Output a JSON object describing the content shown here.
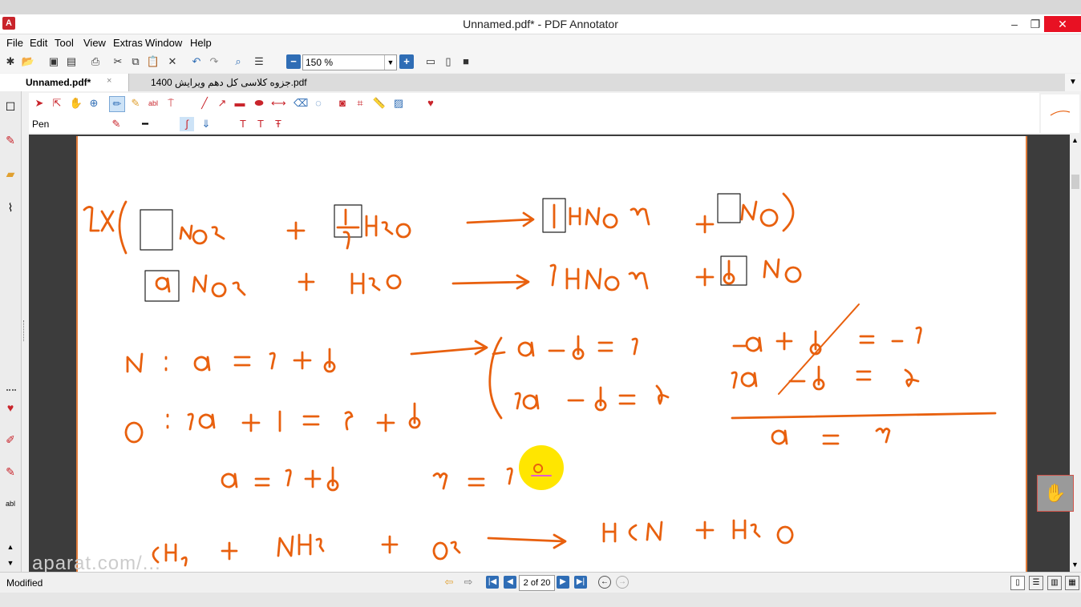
{
  "window": {
    "title": "Unnamed.pdf* - PDF Annotator",
    "app_icon": "pdf-annotator-logo",
    "minimize": "–",
    "maximize": "❐",
    "close": "✕"
  },
  "menu": [
    "File",
    "Edit",
    "Tool",
    "View",
    "Extras",
    "Window",
    "Help"
  ],
  "toolbar": {
    "zoom_value": "150 %",
    "zoom_out": "−",
    "zoom_in": "+"
  },
  "tabs": [
    {
      "label": "Unnamed.pdf*",
      "close": "×",
      "active": true
    },
    {
      "label": "جزوه کلاسی کل دهم ویرایش 1400.pdf",
      "active": false
    }
  ],
  "annotation_toolbar": {
    "current_tool_label": "Pen",
    "accent_color": "#e05a0c"
  },
  "status": {
    "text": "Modified",
    "page_indicator": "2 of 20"
  },
  "document": {
    "ink_color": "#e8600e",
    "page_border_color": "#e07b39",
    "background_color": "#3c3c3c"
  },
  "watermark": "aparat.com/..."
}
